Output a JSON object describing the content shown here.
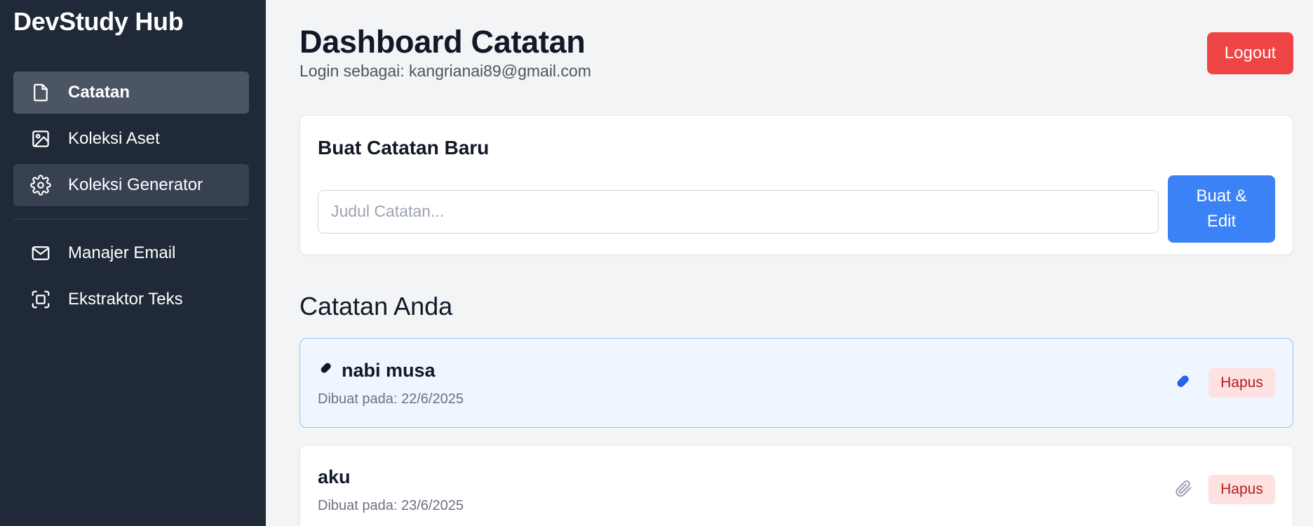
{
  "app": {
    "brand": "DevStudy Hub"
  },
  "sidebar": {
    "items": [
      {
        "label": "Catatan",
        "icon": "file-icon",
        "state": "active"
      },
      {
        "label": "Koleksi Aset",
        "icon": "image-icon",
        "state": "normal"
      },
      {
        "label": "Koleksi Generator",
        "icon": "gear-icon",
        "state": "hover"
      },
      {
        "label": "Manajer Email",
        "icon": "mail-icon",
        "state": "normal"
      },
      {
        "label": "Ekstraktor Teks",
        "icon": "scan-icon",
        "state": "normal"
      }
    ]
  },
  "header": {
    "title": "Dashboard Catatan",
    "subtitle": "Login sebagai: kangrianai89@gmail.com",
    "logout_label": "Logout"
  },
  "new_note": {
    "heading": "Buat Catatan Baru",
    "placeholder": "Judul Catatan...",
    "button_label_line1": "Buat &",
    "button_label_line2": "Edit"
  },
  "notes_section": {
    "heading": "Catatan Anda",
    "notes": [
      {
        "title": "nabi musa",
        "date": "Dibuat pada: 22/6/2025",
        "pinned": true,
        "delete_label": "Hapus"
      },
      {
        "title": "aku",
        "date": "Dibuat pada: 23/6/2025",
        "pinned": false,
        "delete_label": "Hapus"
      }
    ]
  },
  "colors": {
    "sidebar_bg": "#1f2937",
    "active_item": "#4b5563",
    "logout": "#ef4444",
    "primary": "#3b82f6",
    "pinned_bg": "#eff6ff",
    "delete_bg": "#fee2e2",
    "delete_text": "#b91c1c"
  }
}
